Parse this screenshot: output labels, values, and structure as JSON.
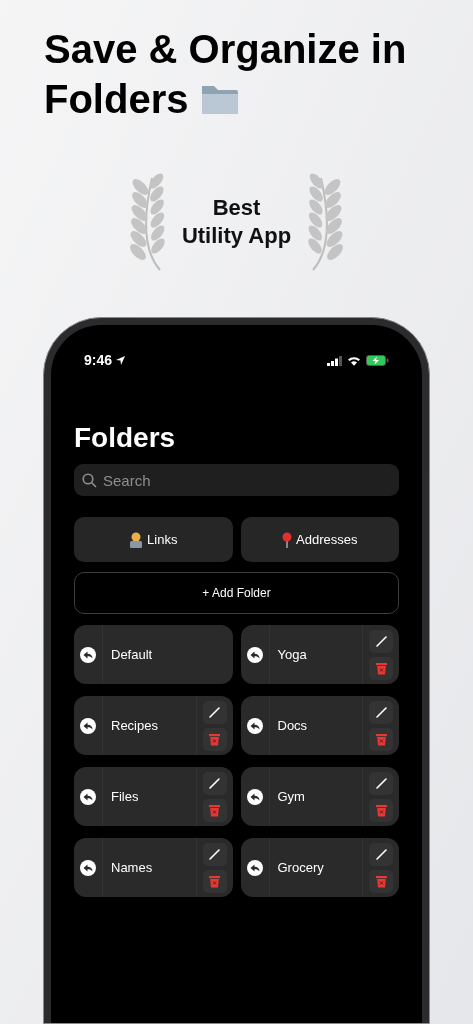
{
  "headline": {
    "line1": "Save & Organize in",
    "line2": "Folders"
  },
  "award": {
    "line1": "Best",
    "line2": "Utility App"
  },
  "status_bar": {
    "time": "9:46"
  },
  "title": "Folders",
  "search": {
    "placeholder": "Search"
  },
  "shortcuts": [
    {
      "kind": "links",
      "label": "Links"
    },
    {
      "kind": "addresses",
      "label": "Addresses"
    }
  ],
  "add_button": "+ Add Folder",
  "folders": [
    {
      "name": "Default",
      "editable": false
    },
    {
      "name": "Yoga",
      "editable": true
    },
    {
      "name": "Recipes",
      "editable": true
    },
    {
      "name": "Docs",
      "editable": true
    },
    {
      "name": "Files",
      "editable": true
    },
    {
      "name": "Gym",
      "editable": true
    },
    {
      "name": "Names",
      "editable": true
    },
    {
      "name": "Grocery",
      "editable": true
    }
  ]
}
